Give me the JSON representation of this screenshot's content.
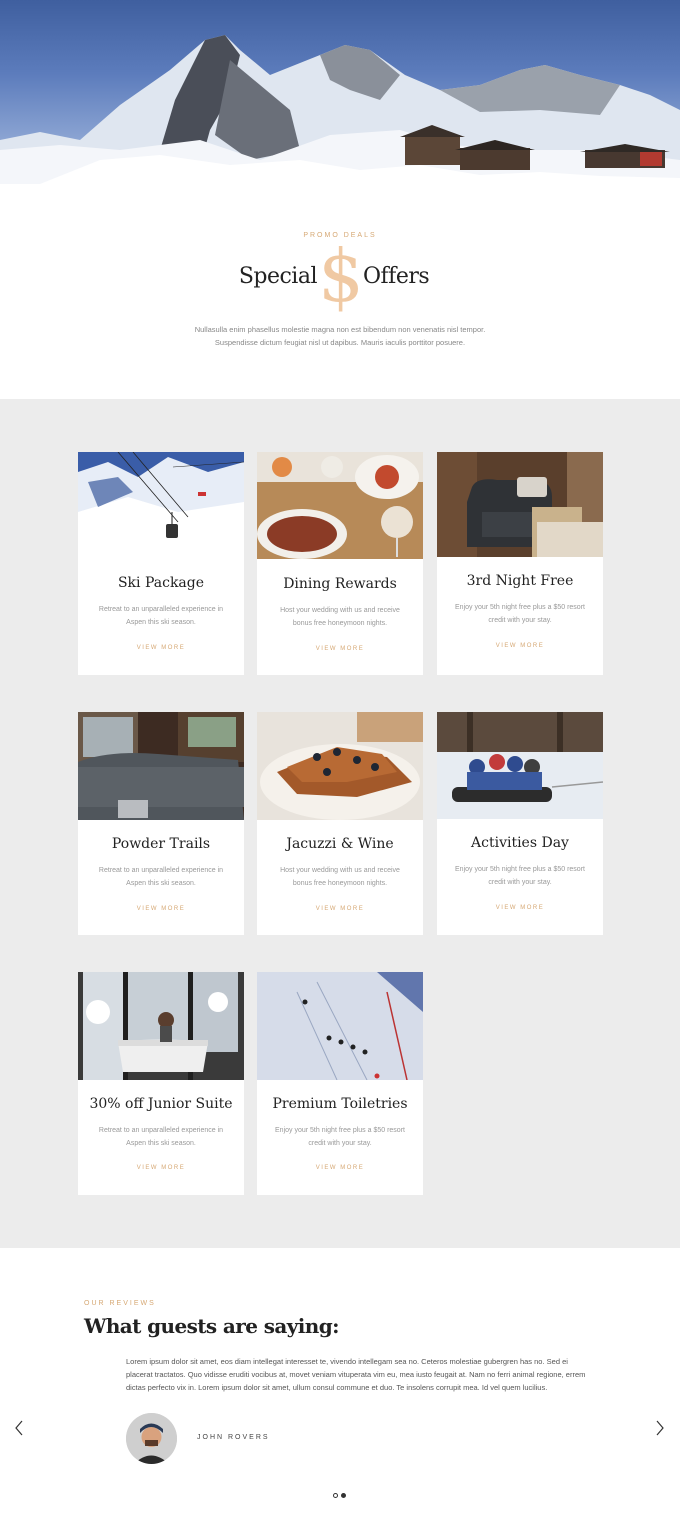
{
  "promo": {
    "eyebrow": "PROMO DEALS",
    "title_left": "Special",
    "title_symbol": "$",
    "title_right": "Offers",
    "description": "Nullasulla enim phasellus molestie magna non est bibendum non venenatis nisl tempor. Suspendisse dictum feugiat nisl ut dapibus. Mauris iaculis porttitor posuere."
  },
  "offers": [
    {
      "title": "Ski Package",
      "description": "Retreat to an unparalleled experience in Aspen this ski season.",
      "link": "VIEW MORE"
    },
    {
      "title": "Dining Rewards",
      "description": "Host your wedding with us and receive bonus free honeymoon nights.",
      "link": "VIEW MORE"
    },
    {
      "title": "3rd Night Free",
      "description": "Enjoy your 5th night free plus a $50 resort credit with your stay.",
      "link": "VIEW MORE"
    },
    {
      "title": "Powder Trails",
      "description": "Retreat to an unparalleled experience in Aspen this ski season.",
      "link": "VIEW MORE"
    },
    {
      "title": "Jacuzzi & Wine",
      "description": "Host your wedding with us and receive bonus free honeymoon nights.",
      "link": "VIEW MORE"
    },
    {
      "title": "Activities Day",
      "description": "Enjoy your 5th night free plus a $50 resort credit with your stay.",
      "link": "VIEW MORE"
    },
    {
      "title": "30% off Junior Suite",
      "description": "Retreat to an unparalleled experience in Aspen this ski season.",
      "link": "VIEW MORE"
    },
    {
      "title": "Premium Toiletries",
      "description": "Enjoy your 5th night free plus a $50 resort credit with your stay.",
      "link": "VIEW MORE"
    }
  ],
  "reviews": {
    "eyebrow": "OUR REVIEWS",
    "title": "What guests are saying:",
    "text": "Lorem ipsum dolor sit amet, eos diam intellegat interesset te, vivendo intellegam sea no. Ceteros molestiae gubergren has no. Sed ei placerat tractatos. Quo vidisse eruditi vocibus at, movet veniam vituperata vim eu, mea iusto feugait at. Nam no ferri animal regione, errem dictas perfecto vix in. Lorem ipsum dolor sit amet, ullum consul commune et duo. Te insolens corrupit mea. Id vel quem lucilius.",
    "reviewer": "JOHN ROVERS",
    "prev_icon": "chevron-left-icon",
    "next_icon": "chevron-right-icon",
    "slides": 2,
    "active_slide": 2
  },
  "colors": {
    "accent": "#d6a874",
    "dollar": "#f0c9a3",
    "section_bg": "#ececec"
  }
}
